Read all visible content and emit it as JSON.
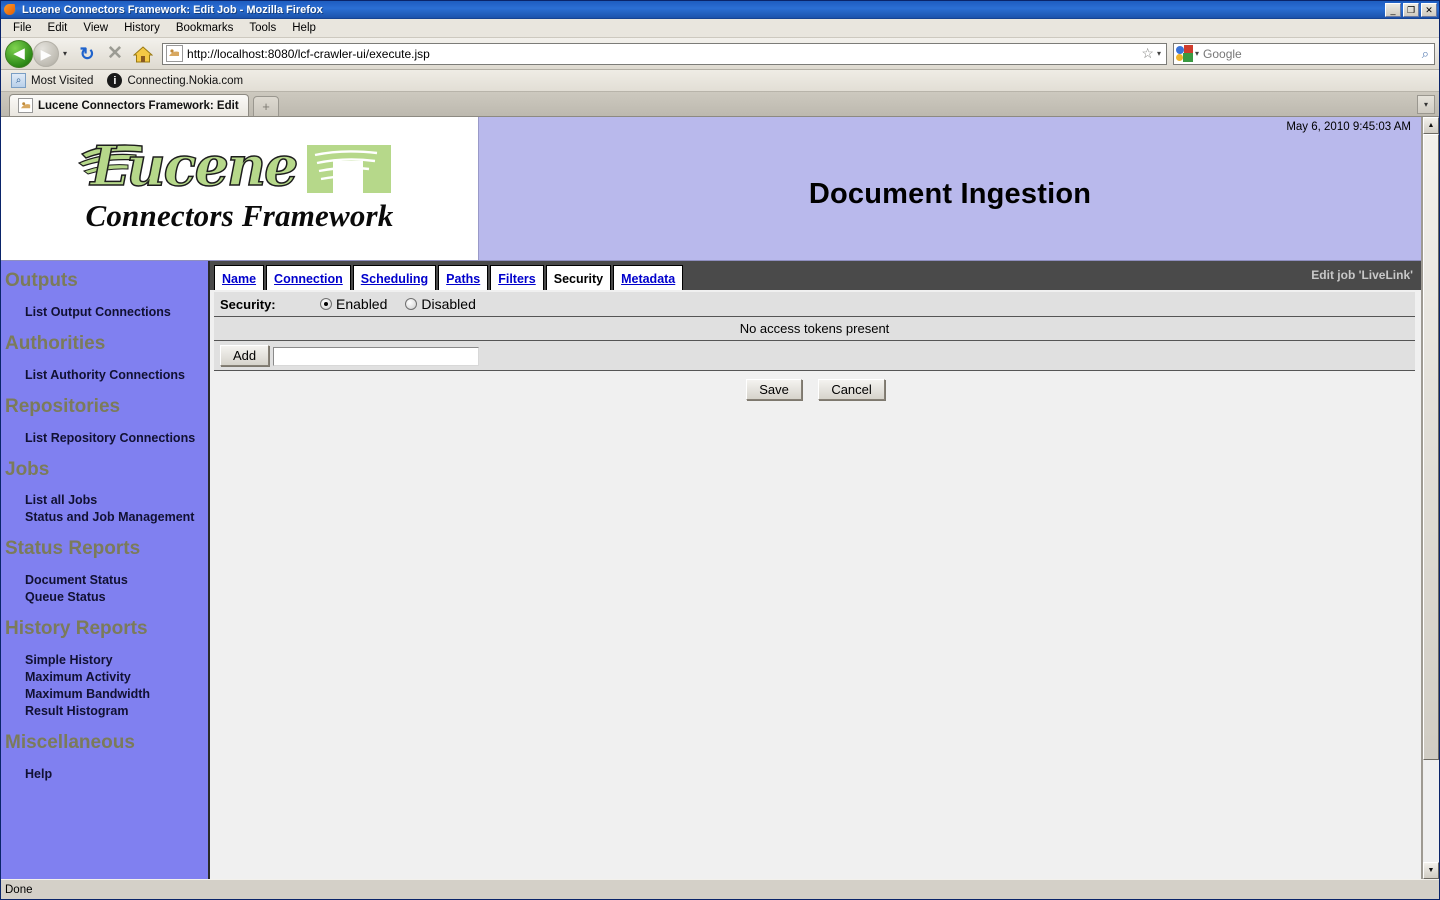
{
  "window": {
    "title": "Lucene Connectors Framework: Edit Job - Mozilla Firefox",
    "app_icon": "firefox-icon",
    "minimize_label": "_",
    "restore_label": "❐",
    "close_label": "✕"
  },
  "menu": {
    "items": [
      "File",
      "Edit",
      "View",
      "History",
      "Bookmarks",
      "Tools",
      "Help"
    ]
  },
  "toolbar": {
    "back_label": "◀",
    "forward_label": "▶",
    "dropdown_caret": "▾",
    "reload_label": "↻",
    "stop_label": "✕",
    "home_label": "⌂",
    "url": "http://localhost:8080/lcf-crawler-ui/execute.jsp",
    "url_placeholder": "Go to a Website",
    "star_label": "☆",
    "search_value": "",
    "search_placeholder": "Google",
    "search_icon": "magnifier-icon",
    "magnifier_label": "⌕"
  },
  "bookmarks": [
    {
      "label": "Most Visited",
      "icon": "most-visited-icon",
      "glyph": "⌕"
    },
    {
      "label": "Connecting.Nokia.com",
      "icon": "info-icon",
      "glyph": "i"
    }
  ],
  "browser_tabs": {
    "tabs": [
      {
        "label": "Lucene Connectors Framework: Edit ...",
        "icon": "page-favicon",
        "active": true
      }
    ],
    "new_tab_label": "+",
    "list_all_label": "▾"
  },
  "page": {
    "logo": {
      "word": "Lucene",
      "subtitle": "Connectors Framework",
      "mark_icon": "lucene-feather-mark"
    },
    "header": {
      "title": "Document Ingestion",
      "date": "May 6, 2010 9:45:03 AM"
    },
    "sidebar": {
      "sections": [
        {
          "heading": "Outputs",
          "links": [
            "List Output Connections"
          ]
        },
        {
          "heading": "Authorities",
          "links": [
            "List Authority Connections"
          ]
        },
        {
          "heading": "Repositories",
          "links": [
            "List Repository Connections"
          ]
        },
        {
          "heading": "Jobs",
          "links": [
            "List all Jobs",
            "Status and Job Management"
          ]
        },
        {
          "heading": "Status Reports",
          "links": [
            "Document Status",
            "Queue Status"
          ]
        },
        {
          "heading": "History Reports",
          "links": [
            "Simple History",
            "Maximum Activity",
            "Maximum Bandwidth",
            "Result Histogram"
          ]
        },
        {
          "heading": "Miscellaneous",
          "links": [
            "Help"
          ]
        }
      ]
    },
    "form_tabs": {
      "tabs": [
        {
          "label": "Name",
          "active": false
        },
        {
          "label": "Connection",
          "active": false
        },
        {
          "label": "Scheduling",
          "active": false
        },
        {
          "label": "Paths",
          "active": false
        },
        {
          "label": "Filters",
          "active": false
        },
        {
          "label": "Security",
          "active": true
        },
        {
          "label": "Metadata",
          "active": false
        }
      ],
      "edit_job_label": "Edit job 'LiveLink'"
    },
    "security_form": {
      "security_label": "Security:",
      "enabled_label": "Enabled",
      "disabled_label": "Disabled",
      "selected": "Enabled",
      "no_tokens_message": "No access tokens present",
      "add_button_label": "Add",
      "token_value": "",
      "token_placeholder": "",
      "save_button_label": "Save",
      "cancel_button_label": "Cancel"
    }
  },
  "scrollbar": {
    "up_label": "▲",
    "down_label": "▼"
  },
  "statusbar": {
    "text": "Done"
  },
  "colors": {
    "header_band": "#b9b9ec",
    "sidebar": "#8080f0",
    "tabbar": "#4a4a4a",
    "link": "#0000cc",
    "nav_heading": "#7b7b5a"
  }
}
